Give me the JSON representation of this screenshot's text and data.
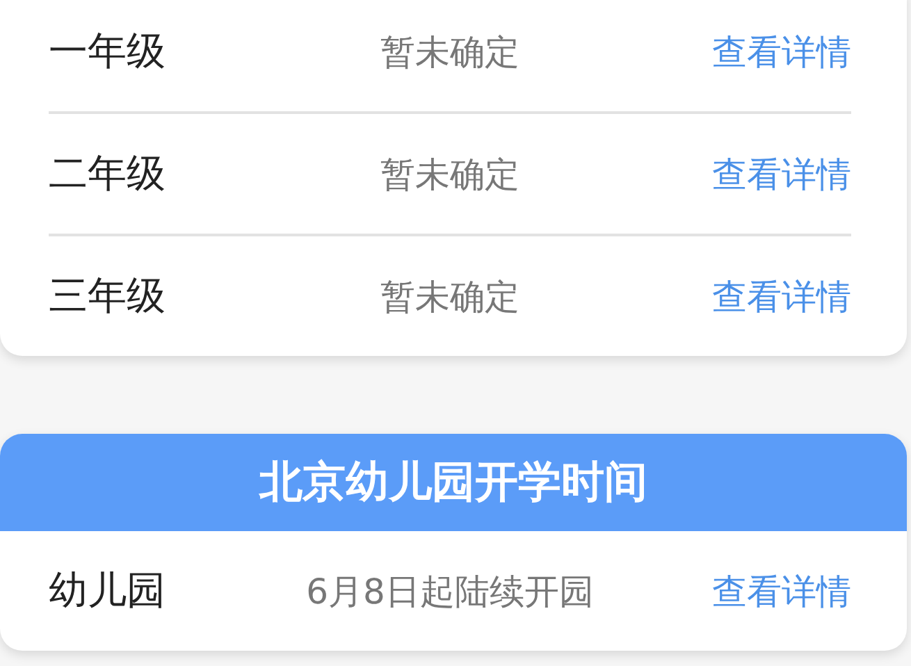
{
  "grade_card": {
    "rows": [
      {
        "label": "一年级",
        "status": "暂未确定",
        "link": "查看详情"
      },
      {
        "label": "二年级",
        "status": "暂未确定",
        "link": "查看详情"
      },
      {
        "label": "三年级",
        "status": "暂未确定",
        "link": "查看详情"
      }
    ]
  },
  "kindergarten_card": {
    "title": "北京幼儿园开学时间",
    "rows": [
      {
        "label": "幼儿园",
        "status": "6月8日起陆续开园",
        "link": "查看详情"
      }
    ]
  }
}
